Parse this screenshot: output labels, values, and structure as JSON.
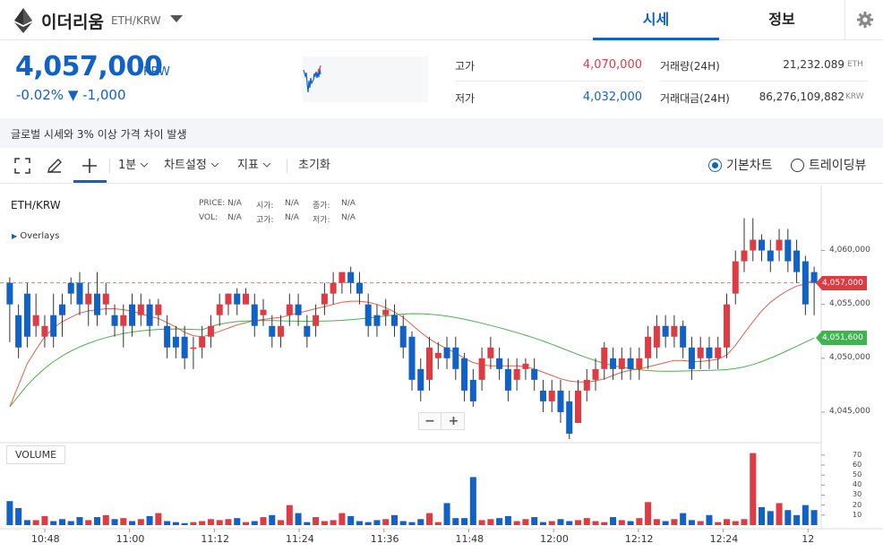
{
  "header": {
    "coin_name": "이더리움",
    "pair": "ETH/KRW",
    "coin_icon": "ethereum-icon",
    "tabs": [
      {
        "label": "시세",
        "active": true
      },
      {
        "label": "정보",
        "active": false
      }
    ],
    "settings_icon": "gear-icon"
  },
  "ticker": {
    "price": "4,057,000",
    "unit": "KRW",
    "change": "-0.02% ▼ -1,000",
    "high_label": "고가",
    "high": "4,070,000",
    "low_label": "저가",
    "low": "4,032,000",
    "volume_label": "거래량(24H)",
    "volume": "21,232.089",
    "volume_unit": "ETH",
    "value_label": "거래대금(24H)",
    "value": "86,276,109,882",
    "value_unit": "KRW"
  },
  "notice": "글로벌 시세와 3% 이상 가격 차이 발생",
  "toolbar": {
    "interval": "1분",
    "chart_settings": "차트설정",
    "indicators": "지표",
    "reset": "초기화",
    "mode_basic": "기본차트",
    "mode_trading": "트레이딩뷰",
    "mode_selected": "기본차트",
    "icons": [
      "fullscreen-icon",
      "pencil-icon",
      "crosshair-icon"
    ]
  },
  "legend": {
    "symbol": "ETH/KRW",
    "price_label": "PRICE:",
    "price": "N/A",
    "open_label": "시가:",
    "open": "N/A",
    "close_label": "종가:",
    "close": "N/A",
    "vol_label": "VOL:",
    "vol": "N/A",
    "high_label": "고가:",
    "high": "N/A",
    "low_label": "저가:",
    "low": "N/A",
    "overlays": "Overlays"
  },
  "zoom": {
    "minus": "−",
    "plus": "+"
  },
  "volume_label": "VOLUME",
  "price_tags": {
    "current": "4,057,000",
    "ma": "4,051,600"
  },
  "colors": {
    "accent": "#1261c4",
    "up": "#dd3c44",
    "down": "#1261c4",
    "ma_short": "#e0604a",
    "ma_long": "#4caf50"
  },
  "chart_data": {
    "type": "candlestick",
    "y_ticks": [
      "4,060,000",
      "4,055,000",
      "4,050,000",
      "4,045,000"
    ],
    "y_tick_values": [
      4060000,
      4055000,
      4050000,
      4045000
    ],
    "ylim": [
      4042500,
      4065700
    ],
    "x_ticks": [
      "10:48",
      "11:00",
      "11:12",
      "11:24",
      "11:36",
      "11:48",
      "12:00",
      "12:12",
      "12:24",
      "12"
    ],
    "vol_ticks": [
      "70",
      "60",
      "50",
      "40",
      "30",
      "20",
      "10"
    ],
    "vol_tick_values": [
      70,
      60,
      50,
      40,
      30,
      20,
      10
    ],
    "vol_lim": [
      0,
      77
    ],
    "current_price": 4057000,
    "candles": [
      [
        4057000,
        4055000,
        4057500,
        4051500
      ],
      [
        4054000,
        4051000,
        4055000,
        4050000
      ],
      [
        4056000,
        4052000,
        4057000,
        4051000
      ],
      [
        4053000,
        4054000,
        4056000,
        4052000
      ],
      [
        4052000,
        4053000,
        4054000,
        4051000
      ],
      [
        4054000,
        4052000,
        4056000,
        4051000
      ],
      [
        4055000,
        4054000,
        4056000,
        4052000
      ],
      [
        4057000,
        4056000,
        4057500,
        4055000
      ],
      [
        4057000,
        4055000,
        4058000,
        4054000
      ],
      [
        4055000,
        4056000,
        4057000,
        4053000
      ],
      [
        4056000,
        4054000,
        4058000,
        4053000
      ],
      [
        4055000,
        4056000,
        4057000,
        4054000
      ],
      [
        4054000,
        4053000,
        4055000,
        4052000
      ],
      [
        4053000,
        4054000,
        4055000,
        4051000
      ],
      [
        4055000,
        4053000,
        4056000,
        4052000
      ],
      [
        4054000,
        4055000,
        4056000,
        4053000
      ],
      [
        4055000,
        4053000,
        4055500,
        4052000
      ],
      [
        4054000,
        4055000,
        4055500,
        4053000
      ],
      [
        4053000,
        4051000,
        4054000,
        4050000
      ],
      [
        4052000,
        4051000,
        4053000,
        4050000
      ],
      [
        4052000,
        4050000,
        4053000,
        4049000
      ],
      [
        4051000,
        4051000,
        4052000,
        4049000
      ],
      [
        4051000,
        4052000,
        4053000,
        4050000
      ],
      [
        4052000,
        4053000,
        4054000,
        4051000
      ],
      [
        4054000,
        4055000,
        4056000,
        4053000
      ],
      [
        4055000,
        4056000,
        4056000,
        4054000
      ],
      [
        4056000,
        4055000,
        4056500,
        4054000
      ],
      [
        4055000,
        4056000,
        4056500,
        4055000
      ],
      [
        4055000,
        4053000,
        4056000,
        4052000
      ],
      [
        4054000,
        4054500,
        4055500,
        4053000
      ],
      [
        4053000,
        4052000,
        4054000,
        4051000
      ],
      [
        4052000,
        4053000,
        4054000,
        4051000
      ],
      [
        4054000,
        4055000,
        4056000,
        4053000
      ],
      [
        4055000,
        4054000,
        4056000,
        4053000
      ],
      [
        4053000,
        4052000,
        4054000,
        4051000
      ],
      [
        4053000,
        4054000,
        4055000,
        4052000
      ],
      [
        4055000,
        4056000,
        4057000,
        4054000
      ],
      [
        4056000,
        4057000,
        4058000,
        4055000
      ],
      [
        4057000,
        4058000,
        4058000,
        4056000
      ],
      [
        4058000,
        4057000,
        4058500,
        4056000
      ],
      [
        4057000,
        4056000,
        4058000,
        4055000
      ],
      [
        4055000,
        4053000,
        4056000,
        4052000
      ],
      [
        4054000,
        4053000,
        4055000,
        4052000
      ],
      [
        4054000,
        4054500,
        4055500,
        4053000
      ],
      [
        4054000,
        4053000,
        4055000,
        4052000
      ],
      [
        4053000,
        4051000,
        4054000,
        4050000
      ],
      [
        4052000,
        4048000,
        4052500,
        4047000
      ],
      [
        4049000,
        4047000,
        4050000,
        4046000
      ],
      [
        4048000,
        4051000,
        4052000,
        4047000
      ],
      [
        4050000,
        4050500,
        4051500,
        4049000
      ],
      [
        4051000,
        4050000,
        4052000,
        4049000
      ],
      [
        4051000,
        4049000,
        4052000,
        4048000
      ],
      [
        4050000,
        4047000,
        4050500,
        4046000
      ],
      [
        4048000,
        4046000,
        4049000,
        4045500
      ],
      [
        4048000,
        4050000,
        4051000,
        4047000
      ],
      [
        4050000,
        4051000,
        4052000,
        4049000
      ],
      [
        4050000,
        4049000,
        4051000,
        4048000
      ],
      [
        4049000,
        4047000,
        4050000,
        4046000
      ],
      [
        4048000,
        4049000,
        4050000,
        4047000
      ],
      [
        4049000,
        4049500,
        4050000,
        4048000
      ],
      [
        4049000,
        4048000,
        4050000,
        4047000
      ],
      [
        4047000,
        4046000,
        4048000,
        4045000
      ],
      [
        4046000,
        4047000,
        4048000,
        4045000
      ],
      [
        4047000,
        4045000,
        4048000,
        4044000
      ],
      [
        4046000,
        4043000,
        4047000,
        4042500
      ],
      [
        4044000,
        4047000,
        4048000,
        4044000
      ],
      [
        4047000,
        4048000,
        4049000,
        4046000
      ],
      [
        4048000,
        4049000,
        4050000,
        4047000
      ],
      [
        4049000,
        4051000,
        4051500,
        4048000
      ],
      [
        4050000,
        4049000,
        4051000,
        4048000
      ],
      [
        4049000,
        4050000,
        4051000,
        4048000
      ],
      [
        4050000,
        4049000,
        4051000,
        4048000
      ],
      [
        4049000,
        4050000,
        4051000,
        4048000
      ],
      [
        4050000,
        4052000,
        4053000,
        4049000
      ],
      [
        4051000,
        4053000,
        4054000,
        4050000
      ],
      [
        4053000,
        4052000,
        4054000,
        4051000
      ],
      [
        4052000,
        4053000,
        4054000,
        4051000
      ],
      [
        4053000,
        4051000,
        4053500,
        4050000
      ],
      [
        4051000,
        4049000,
        4052000,
        4048000
      ],
      [
        4050000,
        4051000,
        4052000,
        4049000
      ],
      [
        4051000,
        4050000,
        4052000,
        4049000
      ],
      [
        4050000,
        4051000,
        4052000,
        4049000
      ],
      [
        4051000,
        4055000,
        4056000,
        4050000
      ],
      [
        4056000,
        4059000,
        4060000,
        4055000
      ],
      [
        4059000,
        4060000,
        4063000,
        4058000
      ],
      [
        4060000,
        4061000,
        4063000,
        4059000
      ],
      [
        4061000,
        4060000,
        4061500,
        4059000
      ],
      [
        4060000,
        4059000,
        4061000,
        4058000
      ],
      [
        4060000,
        4061000,
        4062000,
        4059000
      ],
      [
        4061000,
        4059000,
        4062000,
        4058000
      ],
      [
        4060000,
        4058000,
        4061000,
        4057000
      ],
      [
        4059000,
        4055000,
        4059500,
        4054000
      ],
      [
        4058000,
        4057000,
        4058500,
        4054000
      ]
    ],
    "volumes": [
      24,
      17,
      5,
      5,
      9,
      4,
      6,
      4,
      8,
      5,
      8,
      10,
      6,
      7,
      4,
      6,
      9,
      12,
      4,
      3,
      2,
      3,
      4,
      6,
      5,
      6,
      7,
      3,
      4,
      8,
      10,
      5,
      20,
      12,
      3,
      8,
      4,
      5,
      12,
      9,
      4,
      3,
      5,
      6,
      10,
      4,
      3,
      6,
      12,
      3,
      22,
      7,
      7,
      48,
      5,
      6,
      7,
      9,
      4,
      6,
      8,
      3,
      4,
      6,
      4,
      5,
      7,
      4,
      3,
      8,
      5,
      4,
      7,
      23,
      6,
      4,
      6,
      12,
      5,
      4,
      10,
      3,
      6,
      4,
      6,
      72,
      18,
      14,
      22,
      15,
      10,
      20,
      15,
      7,
      3
    ],
    "ma_short": [
      4045500,
      4047500,
      4049500,
      4050800,
      4052000,
      4052800,
      4053400,
      4053800,
      4054200,
      4054400,
      4054500,
      4054600,
      4054600,
      4054500,
      4054400,
      4054100,
      4053900,
      4053700,
      4053300,
      4052900,
      4052400,
      4052100,
      4052000,
      4052200,
      4052500,
      4052800,
      4053100,
      4053300,
      4053500,
      4053600,
      4053700,
      4053800,
      4054000,
      4054200,
      4054400,
      4054600,
      4054800,
      4055000,
      4055200,
      4055300,
      4055300,
      4055200,
      4055000,
      4054700,
      4054300,
      4053800,
      4053100,
      4052400,
      4051800,
      4051300,
      4050900,
      4050500,
      4050000,
      4049600,
      4049400,
      4049300,
      4049300,
      4049300,
      4049300,
      4049200,
      4049000,
      4048700,
      4048400,
      4048100,
      4047900,
      4047800,
      4047800,
      4047900,
      4048100,
      4048400,
      4048700,
      4048900,
      4049000,
      4049200,
      4049400,
      4049600,
      4049800,
      4049800,
      4049700,
      4049700,
      4049800,
      4049900,
      4050300,
      4051200,
      4052300,
      4053400,
      4054400,
      4055200,
      4055800,
      4056300,
      4056700,
      4056900,
      4057300
    ]
  }
}
